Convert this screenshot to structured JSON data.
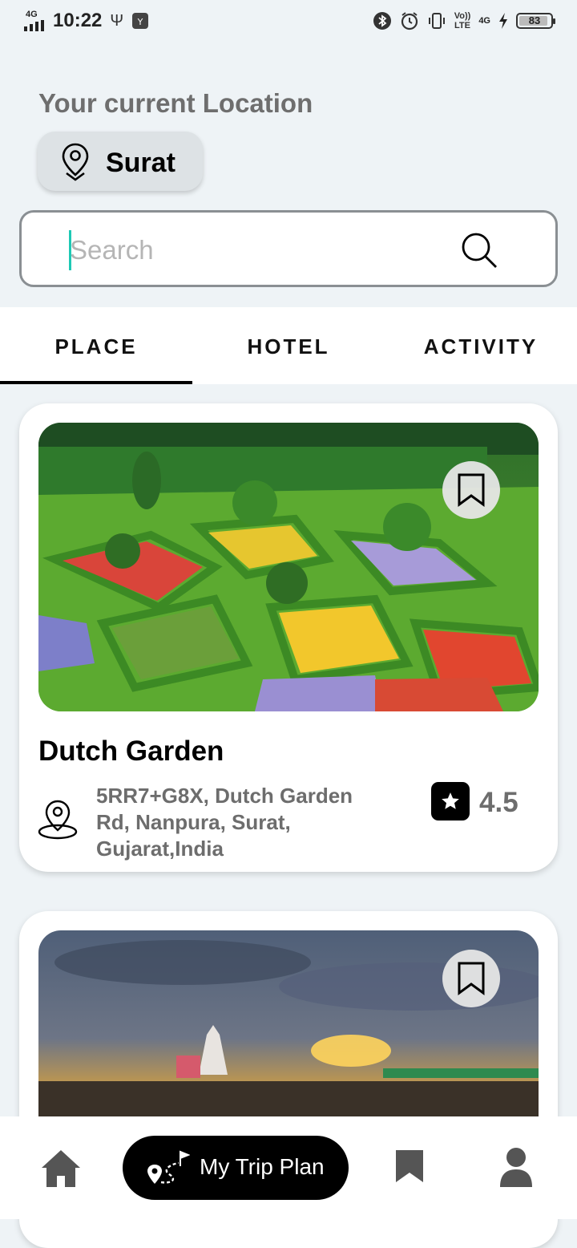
{
  "status_bar": {
    "network_type": "4G",
    "time": "10:22",
    "volte_top": "Vo))",
    "volte_bottom": "LTE",
    "network_right": "4G",
    "battery_percent": "83"
  },
  "location": {
    "title": "Your current Location",
    "city": "Surat"
  },
  "search": {
    "placeholder": "Search",
    "value": ""
  },
  "tabs": [
    {
      "label": "PLACE",
      "active": true
    },
    {
      "label": "HOTEL",
      "active": false
    },
    {
      "label": "ACTIVITY",
      "active": false
    }
  ],
  "places": [
    {
      "name": "Dutch Garden",
      "address": "5RR7+G8X, Dutch Garden Rd, Nanpura, Surat, Gujarat,India",
      "rating": "4.5"
    }
  ],
  "bottom_nav": {
    "trip_plan_label": "My Trip Plan"
  },
  "colors": {
    "accent_caret": "#1ec9b5",
    "background": "#eef3f6",
    "button_dark": "#000000",
    "muted_text": "#6d6d6d"
  },
  "icons": [
    "location-pin-icon",
    "search-icon",
    "bookmark-icon",
    "star-icon",
    "home-icon",
    "route-icon",
    "saved-icon",
    "profile-icon"
  ]
}
